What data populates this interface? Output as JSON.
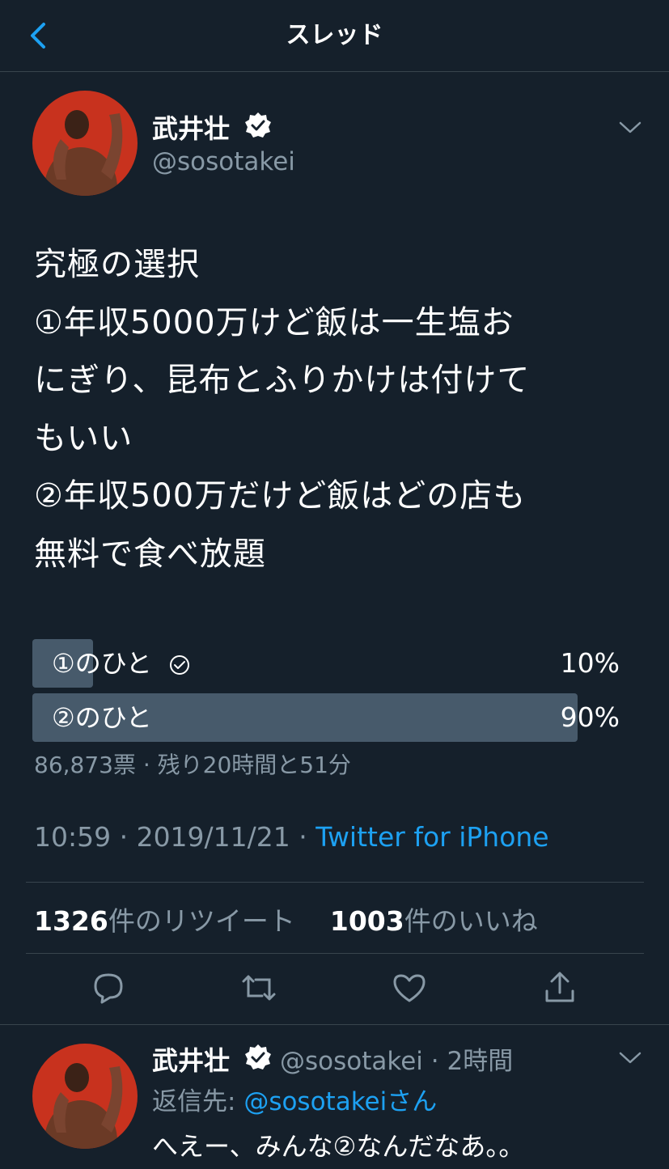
{
  "header": {
    "title": "スレッド"
  },
  "tweet": {
    "author_name": "武井壮",
    "handle": "@sosotakei",
    "text": "究極の選択\n①年収5000万けど飯は一生塩お\nにぎり、昆布とふりかけは付けて\nもいい\n②年収500万だけど飯はどの店も\n無料で食べ放題",
    "poll": {
      "options": [
        {
          "label": "①のひと",
          "percent_label": "10%",
          "fraction": 0.1,
          "selected": true
        },
        {
          "label": "②のひと",
          "percent_label": "90%",
          "fraction": 0.9,
          "selected": false
        }
      ],
      "meta": "86,873票 · 残り20時間と51分"
    },
    "timestamp": "10:59 · 2019/11/21 · ",
    "source": "Twitter for iPhone",
    "retweets_count": "1326",
    "retweets_label": "件のリツイート",
    "likes_count": "1003",
    "likes_label": "件のいいね",
    "icons": [
      "reply-icon",
      "retweet-icon",
      "like-icon",
      "share-icon"
    ]
  },
  "reply": {
    "author_name": "武井壮",
    "handle_time": "@sosotakei · 2時間",
    "reply_to_prefix": "返信先: ",
    "reply_to_mention": "@sosotakeiさん",
    "text": "へえー、みんな②なんだなあ。。"
  },
  "colors": {
    "background": "#15202b",
    "accent": "#1da1f2",
    "muted": "#8899a6",
    "poll_fill": "#475a6b"
  }
}
